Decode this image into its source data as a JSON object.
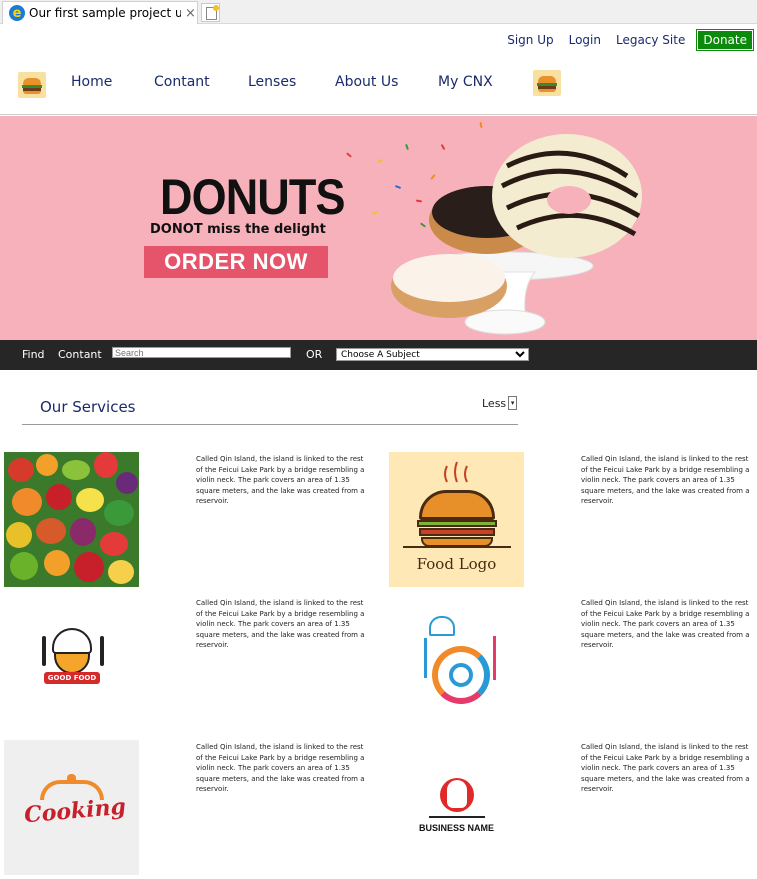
{
  "browser": {
    "tab_title": "Our first sample project usi...",
    "close_glyph": "×"
  },
  "toplinks": {
    "signup": "Sign Up",
    "login": "Login",
    "legacy": "Legacy Site",
    "donate": "Donate",
    "donate_color": "#0b8a0b"
  },
  "nav": {
    "items": [
      "Home",
      "Contant",
      "Lenses",
      "About Us",
      "My CNX"
    ]
  },
  "banner": {
    "heading": "DONUTS",
    "tagline": "DONOT miss the delight",
    "cta": "ORDER NOW",
    "background_color": "#f7b1bb",
    "cta_color": "#e5546b"
  },
  "search": {
    "find_label": "Find",
    "contant_label": "Contant",
    "input_placeholder": "Search",
    "or_label": "OR",
    "subject_selected": "Choose A Subject"
  },
  "services": {
    "title": "Our Services",
    "toggle_label": "Less",
    "cards": [
      {
        "image": "vegetables-photo",
        "text": "Called Qin Island, the island is linked to the rest of the Feicui Lake Park by a bridge resembling a violin neck. The park covers an area of 1.35 square meters, and the lake was created from a reservoir."
      },
      {
        "image": "food-logo",
        "image_text": "Food Logo",
        "text": "Called Qin Island, the island is linked to the rest of the Feicui Lake Park by a bridge resembling a violin neck. The park covers an area of 1.35 square meters, and the lake was created from a reservoir."
      },
      {
        "image": "good-food-logo",
        "image_text": "GOOD FOOD",
        "text": "Called Qin Island, the island is linked to the rest of the Feicui Lake Park by a bridge resembling a violin neck. The park covers an area of 1.35 square meters, and the lake was created from a reservoir."
      },
      {
        "image": "chef-circle-logo",
        "text": "Called Qin Island, the island is linked to the rest of the Feicui Lake Park by a bridge resembling a violin neck. The park covers an area of 1.35 square meters, and the lake was created from a reservoir."
      },
      {
        "image": "cooking-logo",
        "image_text": "Cooking",
        "text": "Called Qin Island, the island is linked to the rest of the Feicui Lake Park by a bridge resembling a violin neck. The park covers an area of 1.35 square meters, and the lake was created from a reservoir."
      },
      {
        "image": "business-name-logo",
        "image_text": "BUSINESS NAME",
        "text": "Called Qin Island, the island is linked to the rest of the Feicui Lake Park by a bridge resembling a violin neck. The park covers an area of 1.35 square meters, and the lake was created from a reservoir."
      }
    ]
  }
}
